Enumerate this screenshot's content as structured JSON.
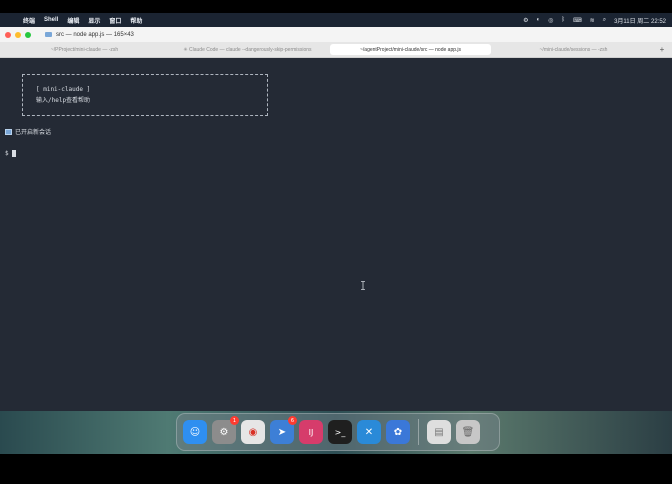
{
  "menubar": {
    "app_name": "终端",
    "items": [
      "Shell",
      "编辑",
      "显示",
      "窗口",
      "帮助"
    ],
    "datetime": "3月11日 周二 22:52"
  },
  "window": {
    "title": "src — node app.js — 165×43",
    "tabs": [
      {
        "label": "~/PProject/mini-claude — -zsh"
      },
      {
        "label": "✳ Claude Code — claude --dangerously-skip-permissions"
      },
      {
        "label": "~/agentProject/mini-claude/src — node app.js"
      },
      {
        "label": "~/mini-claude/sessions — -zsh"
      }
    ],
    "new_tab": "+"
  },
  "terminal": {
    "banner_line1": "[ mini-claude ]",
    "banner_line2": "输入/help查看帮助",
    "session_text": "已开启新会话",
    "prompt": "$"
  },
  "dock": {
    "apps": [
      {
        "name": "finder",
        "glyph": "☺",
        "color": "#2f8ff0"
      },
      {
        "name": "system-settings",
        "glyph": "⚙",
        "color": "#8c8c8c",
        "badge": "1"
      },
      {
        "name": "chrome",
        "glyph": "◉",
        "color": "#e6e6e6"
      },
      {
        "name": "navigator",
        "glyph": "➤",
        "color": "#3d7fd6",
        "badge": "6"
      },
      {
        "name": "intellij",
        "glyph": "IJ",
        "color": "#d63c6b"
      },
      {
        "name": "terminal",
        "glyph": ">_",
        "color": "#1f1f1f"
      },
      {
        "name": "vscode",
        "glyph": "✕",
        "color": "#2a8ad8"
      },
      {
        "name": "app",
        "glyph": "✿",
        "color": "#3b78d8"
      }
    ]
  }
}
